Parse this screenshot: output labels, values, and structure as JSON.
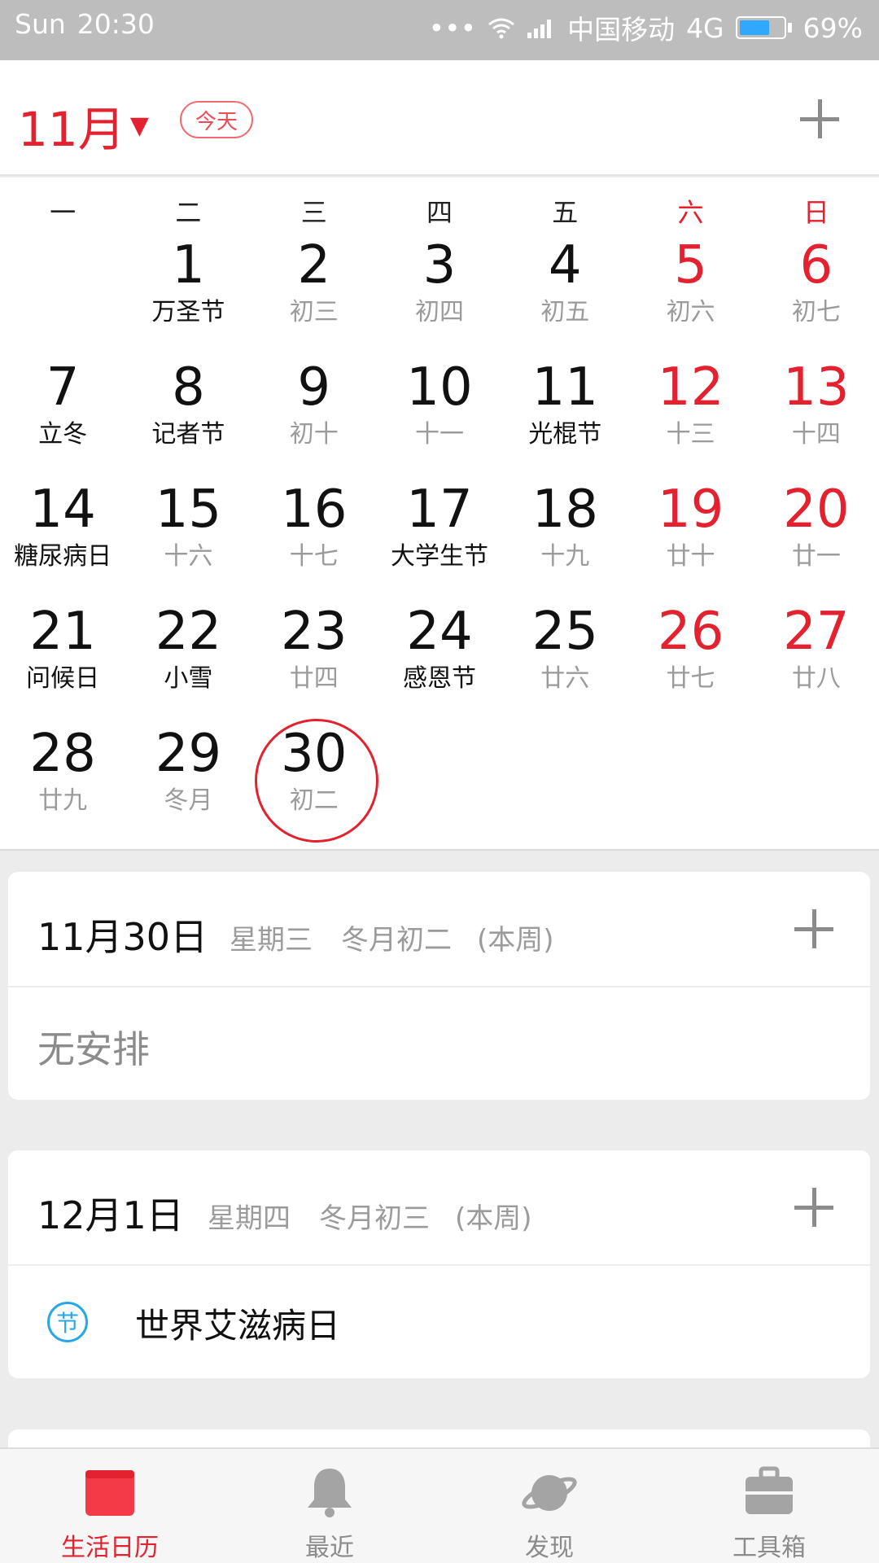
{
  "status_bar": {
    "day": "Sun",
    "time": "20:30",
    "carrier": "中国移动",
    "network": "4G",
    "battery_percent": "69%",
    "battery_level": 0.69
  },
  "header": {
    "month": "11月",
    "today": "今天"
  },
  "calendar": {
    "weekdays": [
      "一",
      "二",
      "三",
      "四",
      "五",
      "六",
      "日"
    ],
    "rows": [
      [
        {
          "d": "",
          "s": ""
        },
        {
          "d": "1",
          "s": "万圣节",
          "h": true
        },
        {
          "d": "2",
          "s": "初三"
        },
        {
          "d": "3",
          "s": "初四"
        },
        {
          "d": "4",
          "s": "初五"
        },
        {
          "d": "5",
          "s": "初六"
        },
        {
          "d": "6",
          "s": "初七"
        }
      ],
      [
        {
          "d": "7",
          "s": "立冬",
          "h": true
        },
        {
          "d": "8",
          "s": "记者节",
          "h": true
        },
        {
          "d": "9",
          "s": "初十"
        },
        {
          "d": "10",
          "s": "十一"
        },
        {
          "d": "11",
          "s": "光棍节",
          "h": true
        },
        {
          "d": "12",
          "s": "十三"
        },
        {
          "d": "13",
          "s": "十四"
        }
      ],
      [
        {
          "d": "14",
          "s": "糖尿病日",
          "h": true
        },
        {
          "d": "15",
          "s": "十六"
        },
        {
          "d": "16",
          "s": "十七"
        },
        {
          "d": "17",
          "s": "大学生节",
          "h": true
        },
        {
          "d": "18",
          "s": "十九"
        },
        {
          "d": "19",
          "s": "廿十"
        },
        {
          "d": "20",
          "s": "廿一"
        }
      ],
      [
        {
          "d": "21",
          "s": "问候日",
          "h": true
        },
        {
          "d": "22",
          "s": "小雪",
          "h": true
        },
        {
          "d": "23",
          "s": "廿四"
        },
        {
          "d": "24",
          "s": "感恩节",
          "h": true
        },
        {
          "d": "25",
          "s": "廿六"
        },
        {
          "d": "26",
          "s": "廿七"
        },
        {
          "d": "27",
          "s": "廿八"
        }
      ],
      [
        {
          "d": "28",
          "s": "廿九"
        },
        {
          "d": "29",
          "s": "冬月"
        },
        {
          "d": "30",
          "s": "初二",
          "selected": true
        },
        {
          "d": "",
          "s": ""
        },
        {
          "d": "",
          "s": ""
        },
        {
          "d": "",
          "s": ""
        },
        {
          "d": "",
          "s": ""
        }
      ]
    ]
  },
  "cards": [
    {
      "date": "11月30日",
      "weekday": "星期三",
      "lunar": "冬月初二",
      "week_note": "(本周)",
      "empty_text": "无安排"
    },
    {
      "date": "12月1日",
      "weekday": "星期四",
      "lunar": "冬月初三",
      "week_note": "(本周)",
      "event_icon": "节",
      "event_text": "世界艾滋病日"
    }
  ],
  "nav": [
    {
      "label": "生活日历",
      "icon": "calendar-icon",
      "active": true
    },
    {
      "label": "最近",
      "icon": "bell-icon"
    },
    {
      "label": "发现",
      "icon": "planet-icon"
    },
    {
      "label": "工具箱",
      "icon": "toolbox-icon"
    }
  ],
  "colors": {
    "accent": "#e3212f",
    "event_blue": "#27a7e7"
  }
}
